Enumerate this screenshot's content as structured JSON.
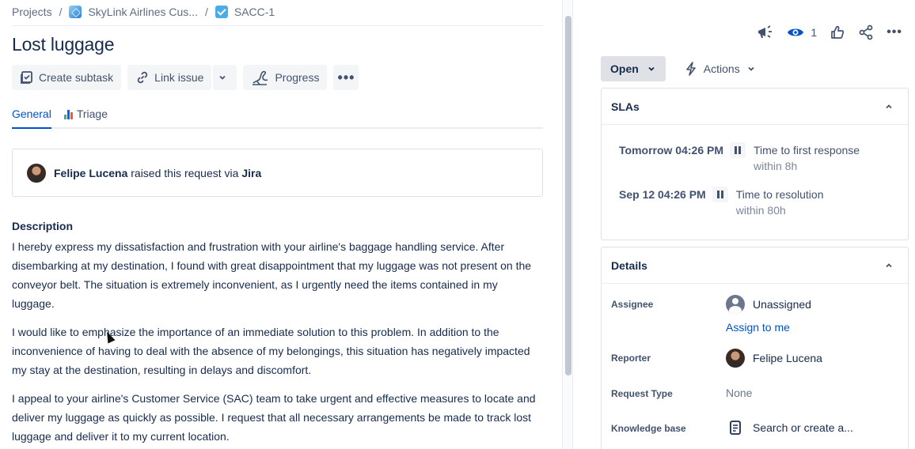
{
  "breadcrumb": {
    "projects": "Projects",
    "project": "SkyLink Airlines Cus...",
    "issue_key": "SACC-1",
    "separator": "/"
  },
  "issue": {
    "title": "Lost luggage"
  },
  "toolbar": {
    "create_subtask": "Create subtask",
    "link_issue": "Link issue",
    "progress": "Progress",
    "more": "•••"
  },
  "tabs": [
    {
      "label": "General",
      "active": true
    },
    {
      "label": "Triage",
      "active": false
    }
  ],
  "request": {
    "reporter_name": "Felipe Lucena",
    "middle_text": "raised this request via",
    "channel": "Jira"
  },
  "description": {
    "heading": "Description",
    "paragraphs": [
      "I hereby express my dissatisfaction and frustration with your airline's baggage handling service. After disembarking at my destination, I found with great disappointment that my luggage was not present on the conveyor belt. The situation is extremely inconvenient, as I urgently need the items contained in my luggage.",
      "I would like to emphasize the importance of an immediate solution to this problem. In addition to the inconvenience of having to deal with the absence of my belongings, this situation has negatively impacted my stay at the destination, resulting in delays and discomfort.",
      "I appeal to your airline's Customer Service (SAC) team to take urgent and effective measures to locate and deliver my luggage as quickly as possible. I request that all necessary arrangements be made to track lost luggage and deliver it to my current location."
    ]
  },
  "top_actions": {
    "watchers_count": "1",
    "more": "•••"
  },
  "status": {
    "label": "Open",
    "actions_label": "Actions"
  },
  "slas": {
    "title": "SLAs",
    "items": [
      {
        "time": "Tomorrow 04:26 PM",
        "goal": "Time to first response",
        "within": "within 8h"
      },
      {
        "time": "Sep 12 04:26 PM",
        "goal": "Time to resolution",
        "within": "within 80h"
      }
    ]
  },
  "details": {
    "title": "Details",
    "assignee_label": "Assignee",
    "assignee_value": "Unassigned",
    "assign_to_me": "Assign to me",
    "reporter_label": "Reporter",
    "reporter_value": "Felipe Lucena",
    "request_type_label": "Request Type",
    "request_type_value": "None",
    "knowledge_base_label": "Knowledge base",
    "knowledge_base_value": "Search or create a..."
  },
  "colors": {
    "link": "#0052cc",
    "text": "#172b4d",
    "muted": "#6b778c",
    "button_bg": "#f4f5f7",
    "status_bg": "#dfe1e6"
  },
  "icons": {
    "announce": "megaphone-icon",
    "watch": "eye-icon",
    "like": "thumbs-up-icon",
    "share": "share-icon"
  }
}
